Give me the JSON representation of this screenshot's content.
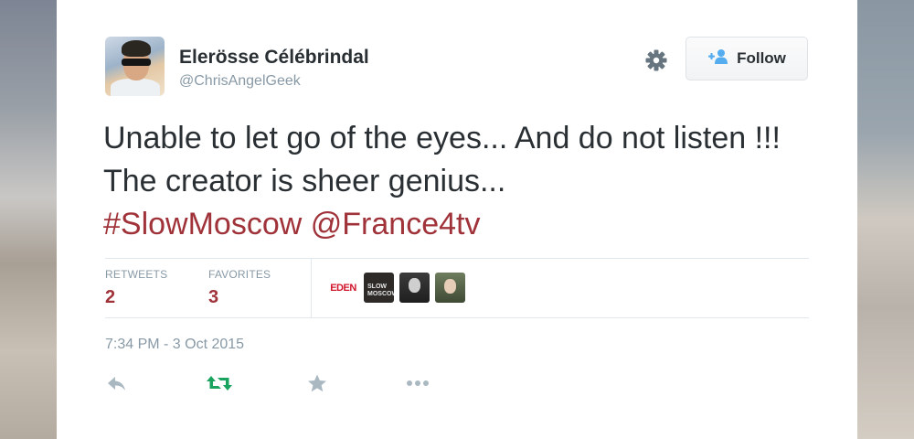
{
  "tweet": {
    "author_name": "Elerösse Célébrindal",
    "author_handle": "@ChrisAngelGeek",
    "text_plain": "Unable to let go of the eyes... And do not listen !!! The creator is sheer genius...",
    "hashtag": "#SlowMoscow",
    "mention": "@France4tv",
    "timestamp": "7:34 PM - 3 Oct 2015"
  },
  "follow_button": {
    "label": "Follow",
    "icon": "add-user-icon"
  },
  "settings": {
    "icon": "gear-icon"
  },
  "stats": {
    "retweets_label": "RETWEETS",
    "retweets_count": "2",
    "favorites_label": "FAVORITES",
    "favorites_count": "3"
  },
  "favoriters": [
    {
      "name": "eden-avatar",
      "text": "EDEN"
    },
    {
      "name": "slow-moscow-avatar",
      "text": "SLOW MOSCOW"
    },
    {
      "name": "man-avatar",
      "text": ""
    },
    {
      "name": "woman-avatar",
      "text": ""
    }
  ],
  "actions": [
    {
      "name": "reply-icon"
    },
    {
      "name": "retweet-icon"
    },
    {
      "name": "favorite-icon"
    },
    {
      "name": "more-icon"
    }
  ],
  "colors": {
    "link": "#a0333a",
    "text": "#292f33",
    "muted": "#8899a6",
    "retweet_green": "#19a35f",
    "icon_gray": "#aab8c2"
  }
}
